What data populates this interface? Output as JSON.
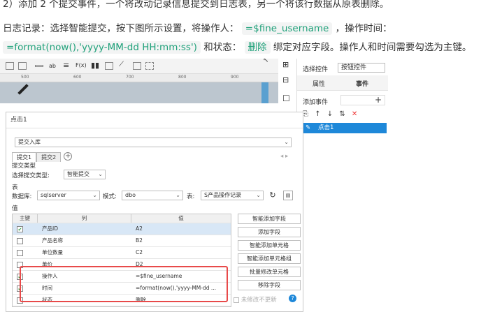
{
  "doc": {
    "line1": "2）添加 2 个提交事件，一个将改动记录信息提交到日志表，另一个将该行数据从原表删除。",
    "line2_a": "日志记录：选择智能提交，按下图所示设置，将操作人：",
    "line2_code": "=$fine_username",
    "line2_b": "，操作时间：",
    "line3_code1": "=format(now(),'yyyy-MM-dd HH:mm:ss')",
    "line3_a": "和状态：",
    "line3_code2": "删除",
    "line3_b": "绑定对应字段。操作人和时间需要勾选为主键。"
  },
  "ruler": {
    "ticks": [
      "500",
      "600",
      "700",
      "800",
      "900"
    ]
  },
  "right_panel": {
    "select_control_label": "选择控件",
    "select_control_value": "按钮控件",
    "tab_properties": "属性",
    "tab_events": "事件",
    "add_event_label": "添加事件",
    "event_item": "点击1"
  },
  "dialog": {
    "title": "点击1",
    "submit_type": "提交入库",
    "tabs": [
      "提交1",
      "提交2"
    ],
    "section_submit_type": "提交类型",
    "choose_submit_type_label": "选择提交类型:",
    "choose_submit_type_value": "智能提交",
    "section_table": "表",
    "db_label": "数据库:",
    "db_value": "sqlserver",
    "schema_label": "模式:",
    "schema_value": "dbo",
    "table_label": "表:",
    "table_value": "S产品操作记录",
    "section_value": "值",
    "col_key": "主键",
    "col_column": "列",
    "col_value": "值",
    "rows": [
      {
        "key": true,
        "column": "产品ID",
        "value": "A2"
      },
      {
        "key": false,
        "column": "产品名称",
        "value": "B2"
      },
      {
        "key": false,
        "column": "单位数量",
        "value": "C2"
      },
      {
        "key": false,
        "column": "单价",
        "value": "D2"
      },
      {
        "key": true,
        "column": "操作人",
        "value": "=$fine_username"
      },
      {
        "key": true,
        "column": "时间",
        "value": "=format(now(),'yyyy-MM-dd ..."
      },
      {
        "key": false,
        "column": "状态",
        "value": "删除"
      }
    ],
    "buttons": [
      "智能添加字段",
      "添加字段",
      "智能添加单元格",
      "智能添加单元格组",
      "批量修改单元格",
      "移除字段"
    ],
    "unmodified_label": "未修改不更新",
    "help_icon_text": "?"
  },
  "colors": {
    "accent_green": "#20a17a",
    "highlight_red": "#e84a4a",
    "selected_blue": "#1e88d9"
  }
}
